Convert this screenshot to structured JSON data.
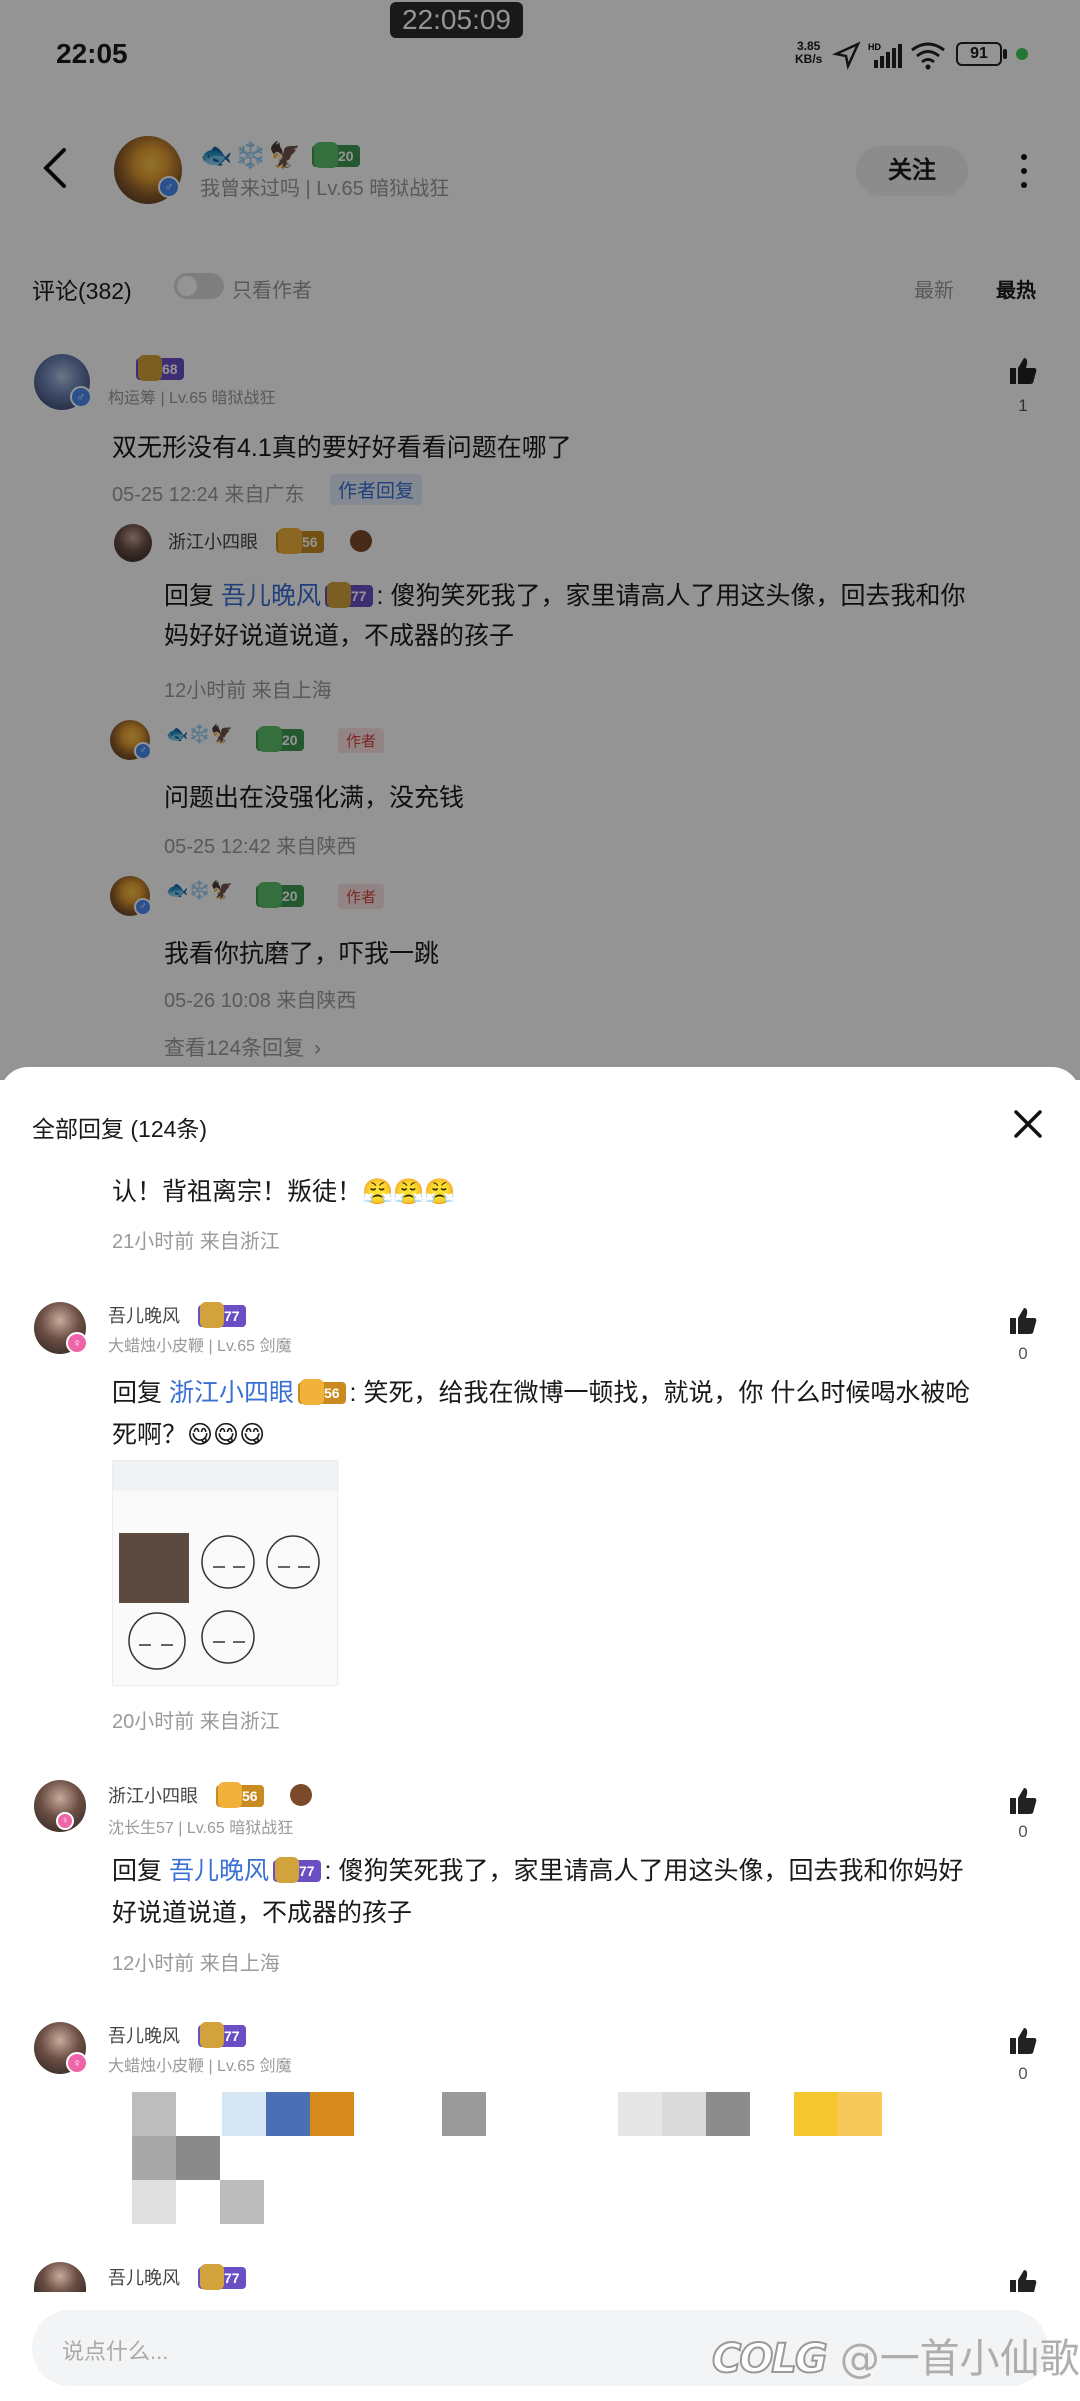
{
  "status_bar": {
    "time": "22:05",
    "recording_time": "22:05:09",
    "net_speed_value": "3.85",
    "net_speed_unit": "KB/s",
    "battery": "91"
  },
  "header": {
    "title_badge_level": "20",
    "subtitle": "我曾来过吗 | Lv.65 暗狱战狂",
    "follow_label": "关注"
  },
  "comments_bar": {
    "title": "评论(382)",
    "only_author_label": "只看作者",
    "sort_latest": "最新",
    "sort_hot": "最热"
  },
  "main_comment": {
    "level": "68",
    "sub": "构运筹 | Lv.65 暗狱战狂",
    "text": "双无形没有4.1真的要好好看看问题在哪了",
    "meta": "05-25 12:24  来自广东",
    "author_reply_tag": "作者回复",
    "likes": "1"
  },
  "sub_replies": [
    {
      "name": "浙江小四眼",
      "level": "56",
      "reply_prefix": "回复 ",
      "reply_target": "吾儿晚风",
      "reply_target_level": "77",
      "text": ": 傻狗笑死我了，家里请高人了用这头像，回去我和你妈好好说道说道，不成器的孩子",
      "meta": "12小时前  来自上海"
    },
    {
      "level": "20",
      "author_tag": "作者",
      "text": "问题出在没强化满，没充钱",
      "meta": "05-25 12:42  来自陕西"
    },
    {
      "level": "20",
      "author_tag": "作者",
      "text": "我看你抗磨了，吓我一跳",
      "meta": "05-26 10:08  来自陕西"
    }
  ],
  "view_more_label": "查看124条回复",
  "sheet": {
    "title": "全部回复 (124条)",
    "partial_text": "认！背祖离宗！叛徒！😤😤😤",
    "partial_meta": "21小时前  来自浙江",
    "replies": [
      {
        "name": "吾儿晚风",
        "level": "77",
        "sub": "大蜡烛小皮鞭 | Lv.65 剑魔",
        "reply_prefix": "回复 ",
        "reply_target": "浙江小四眼",
        "reply_target_level": "56",
        "text": ": 笑死，给我在微博一顿找，就说，你    什么时候喝水被呛死啊？😋😋😋",
        "meta": "20小时前  来自浙江",
        "likes": "0"
      },
      {
        "name": "浙江小四眼",
        "level": "56",
        "sub": "沈长生57 | Lv.65 暗狱战狂",
        "reply_prefix": "回复 ",
        "reply_target": "吾儿晚风",
        "reply_target_level": "77",
        "text": ": 傻狗笑死我了，家里请高人了用这头像，回去我和你妈好好说道说道，不成器的孩子",
        "meta": "12小时前  来自上海",
        "likes": "0"
      },
      {
        "name": "吾儿晚风",
        "level": "77",
        "sub": "大蜡烛小皮鞭 | Lv.65 剑魔",
        "likes": "0"
      },
      {
        "name": "吾儿晚风",
        "level": "77"
      }
    ],
    "input_placeholder": "说点什么..."
  },
  "watermark": "@一首小仙歌"
}
